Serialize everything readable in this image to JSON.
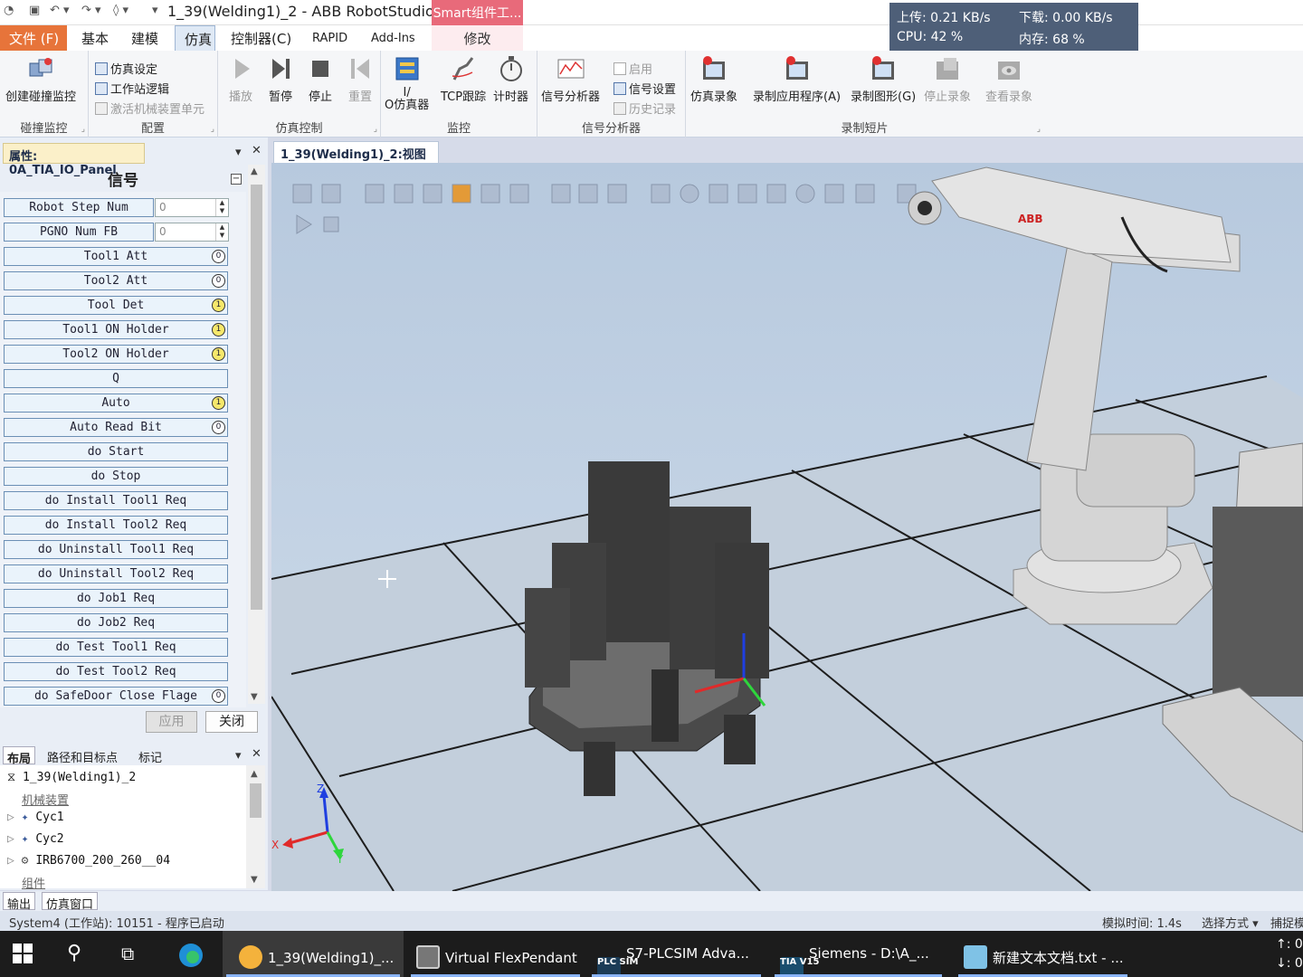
{
  "window": {
    "title": "1_39(Welding1)_2 - ABB RobotStudio...",
    "context_tab_header": "Smart组件工..."
  },
  "net": {
    "upload": "上传: 0.21 KB/s",
    "download": "下载: 0.00 KB/s",
    "cpu": "CPU: 42 %",
    "mem": "内存: 68 %"
  },
  "tabs": {
    "file": "文件 (F)",
    "basic": "基本",
    "modeling": "建模",
    "simulation": "仿真",
    "controller": "控制器(C)",
    "rapid": "RAPID",
    "addins": "Add-Ins",
    "modify": "修改"
  },
  "ribbon": {
    "collision": {
      "btn": "创建碰撞监控",
      "label": "碰撞监控"
    },
    "config": {
      "sim_setup": "仿真设定",
      "station_logic": "工作站逻辑",
      "activate_mech": "激活机械装置单元",
      "label": "配置"
    },
    "sim_control": {
      "play": "播放",
      "pause": "暂停",
      "stop": "停止",
      "reset": "重置",
      "label": "仿真控制"
    },
    "monitor": {
      "io_sim_line1": "I/",
      "io_sim_line2": "O仿真器",
      "tcp_trace": "TCP跟踪",
      "timer": "计时器",
      "label": "监控"
    },
    "signal_analyzer": {
      "analyzer": "信号分析器",
      "enable": "启用",
      "signal_setup": "信号设置",
      "history": "历史记录",
      "label": "信号分析器"
    },
    "record": {
      "sim_record": "仿真录象",
      "record_app": "录制应用程序(A)",
      "record_graphics": "录制图形(G)",
      "stop_record": "停止录象",
      "view_record": "查看录象",
      "label": "录制短片"
    }
  },
  "properties_panel": {
    "tab": "属性: 0A_TIA_IO_Panel",
    "title": "信号"
  },
  "signals": [
    {
      "name": "Robot Step Num",
      "type": "num",
      "value": "0"
    },
    {
      "name": "PGNO Num FB",
      "type": "num",
      "value": "0"
    },
    {
      "name": "Tool1 Att",
      "type": "lamp",
      "state": "0"
    },
    {
      "name": "Tool2 Att",
      "type": "lamp",
      "state": "0"
    },
    {
      "name": "Tool Det",
      "type": "lamp",
      "state": "1"
    },
    {
      "name": "Tool1 ON Holder",
      "type": "lamp",
      "state": "1"
    },
    {
      "name": "Tool2 ON Holder",
      "type": "lamp",
      "state": "1"
    },
    {
      "name": "Q",
      "type": "button"
    },
    {
      "name": "Auto",
      "type": "lamp",
      "state": "1"
    },
    {
      "name": "Auto Read Bit",
      "type": "lamp",
      "state": "0"
    },
    {
      "name": "do Start",
      "type": "button"
    },
    {
      "name": "do Stop",
      "type": "button"
    },
    {
      "name": "do Install Tool1 Req",
      "type": "button"
    },
    {
      "name": "do Install Tool2 Req",
      "type": "button"
    },
    {
      "name": "do Uninstall Tool1 Req",
      "type": "button"
    },
    {
      "name": "do Uninstall Tool2 Req",
      "type": "button"
    },
    {
      "name": "do Job1 Req",
      "type": "button"
    },
    {
      "name": "do Job2 Req",
      "type": "button"
    },
    {
      "name": "do Test Tool1 Req",
      "type": "button"
    },
    {
      "name": "do Test Tool2 Req",
      "type": "button"
    },
    {
      "name": "do SafeDoor Close Flage",
      "type": "lamp",
      "state": "0"
    }
  ],
  "dialog": {
    "apply": "应用",
    "close": "关闭"
  },
  "layout_panel": {
    "tabs": [
      "布局",
      "路径和目标点",
      "标记"
    ],
    "tree": [
      {
        "label": "1_39(Welding1)_2",
        "kind": "station"
      },
      {
        "label": "机械装置",
        "kind": "heading"
      },
      {
        "label": "Cyc1",
        "kind": "mech"
      },
      {
        "label": "Cyc2",
        "kind": "mech"
      },
      {
        "label": "IRB6700_200_260__04",
        "kind": "robot"
      },
      {
        "label": "组件",
        "kind": "heading"
      }
    ]
  },
  "document": {
    "tab": "1_39(Welding1)_2:视图1"
  },
  "viewport": {
    "axes": {
      "x": "X",
      "y": "Y",
      "z": "Z"
    },
    "robot_brand": "ABB"
  },
  "bottom_tabs": [
    "输出",
    "仿真窗口"
  ],
  "status": {
    "left": "System4 (工作站): 10151 - 程序已启动",
    "sim_time": "模拟时间: 1.4s",
    "select_mode": "选择方式 ▾",
    "capture_mode": "捕捉模"
  },
  "taskbar": {
    "items": [
      "1_39(Welding1)_...",
      "Virtual FlexPendant",
      "S7-PLCSIM Adva...",
      "Siemens  -  D:\\A_...",
      "新建文本文档.txt - ..."
    ],
    "tray_up": "↑: 0.",
    "tray_down": "↓: 0."
  }
}
